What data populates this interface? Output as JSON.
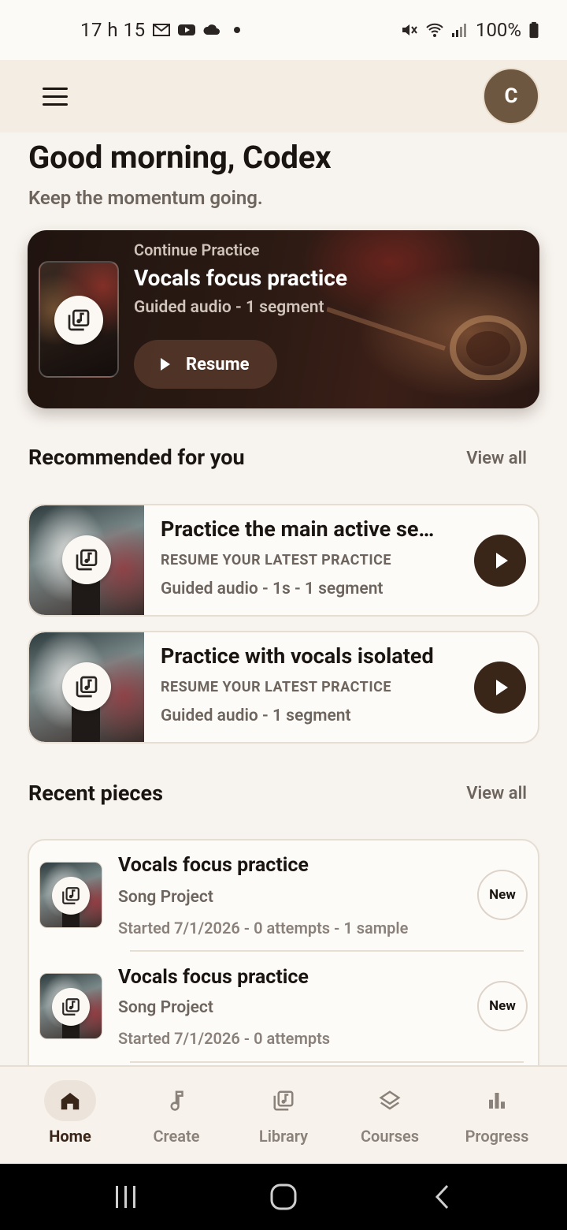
{
  "status_bar": {
    "time": "17 h 15",
    "battery": "100%",
    "left_icons": [
      "gmail-icon",
      "youtube-icon",
      "cloud-icon",
      "dot-icon"
    ],
    "right_icons": [
      "mute-icon",
      "wifi-icon",
      "signal-icon",
      "battery-icon"
    ]
  },
  "app_bar": {
    "avatar_initial": "C",
    "avatar_color": "#6e5740"
  },
  "greeting": {
    "title": "Good morning, Codex",
    "subtitle": "Keep the momentum going."
  },
  "continue_card": {
    "eyebrow": "Continue Practice",
    "title": "Vocals focus practice",
    "meta": "Guided audio - 1 segment",
    "resume_label": "Resume"
  },
  "recommended": {
    "title": "Recommended for you",
    "view_all": "View all",
    "items": [
      {
        "title": "Practice the main active se…",
        "kicker": "RESUME YOUR LATEST PRACTICE",
        "meta": "Guided audio - 1s - 1 segment"
      },
      {
        "title": "Practice with vocals isolated",
        "kicker": "RESUME YOUR LATEST PRACTICE",
        "meta": "Guided audio - 1 segment"
      }
    ]
  },
  "recent": {
    "title": "Recent pieces",
    "view_all": "View all",
    "items": [
      {
        "title": "Vocals focus practice",
        "subtitle": "Song Project",
        "meta": "Started 7/1/2026 - 0 attempts - 1 sample",
        "badge": "New"
      },
      {
        "title": "Vocals focus practice",
        "subtitle": "Song Project",
        "meta": "Started 7/1/2026 - 0 attempts",
        "badge": "New"
      }
    ]
  },
  "bottom_nav": {
    "items": [
      {
        "label": "Home",
        "icon": "home-icon",
        "active": true
      },
      {
        "label": "Create",
        "icon": "music-note-icon",
        "active": false
      },
      {
        "label": "Library",
        "icon": "library-icon",
        "active": false
      },
      {
        "label": "Courses",
        "icon": "layers-icon",
        "active": false
      },
      {
        "label": "Progress",
        "icon": "bar-chart-icon",
        "active": false
      }
    ]
  },
  "colors": {
    "background": "#f7f3ee",
    "accent_dark": "#3a2519",
    "muted_text": "#6d645d"
  }
}
